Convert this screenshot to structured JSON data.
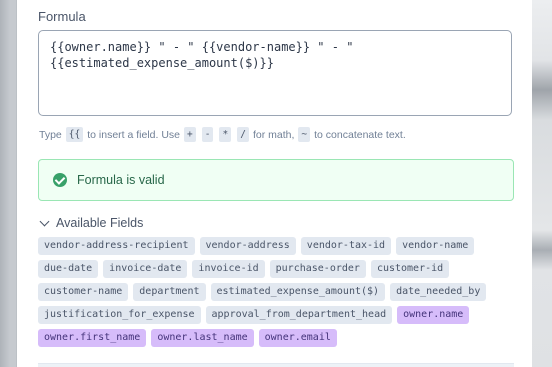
{
  "formula": {
    "label": "Formula",
    "value": "{{owner.name}} \" - \" {{vendor-name}} \" - \"\n{{estimated_expense_amount($)}}"
  },
  "hint": {
    "type_word": "Type",
    "field_token": "{{",
    "insert_text": "to insert a field. Use",
    "ops": [
      "+",
      "-",
      "*",
      "/"
    ],
    "math_text": "for math,",
    "concat_token": "~",
    "concat_text": "to concatenate text."
  },
  "validation": {
    "message": "Formula is valid",
    "status_color": "#38a169"
  },
  "fields": {
    "title": "Available Fields",
    "rows": [
      [
        {
          "label": "vendor-address-recipient",
          "highlight": false
        },
        {
          "label": "vendor-address",
          "highlight": false
        },
        {
          "label": "vendor-tax-id",
          "highlight": false
        },
        {
          "label": "vendor-name",
          "highlight": false
        }
      ],
      [
        {
          "label": "due-date",
          "highlight": false
        },
        {
          "label": "invoice-date",
          "highlight": false
        },
        {
          "label": "invoice-id",
          "highlight": false
        },
        {
          "label": "purchase-order",
          "highlight": false
        },
        {
          "label": "customer-id",
          "highlight": false
        }
      ],
      [
        {
          "label": "customer-name",
          "highlight": false
        },
        {
          "label": "department",
          "highlight": false
        },
        {
          "label": "estimated_expense_amount($)",
          "highlight": false
        },
        {
          "label": "date_needed_by",
          "highlight": false
        }
      ],
      [
        {
          "label": "justification_for_expense",
          "highlight": false
        },
        {
          "label": "approval_from_department_head",
          "highlight": false
        },
        {
          "label": "owner.name",
          "highlight": true
        }
      ],
      [
        {
          "label": "owner.first_name",
          "highlight": true
        },
        {
          "label": "owner.last_name",
          "highlight": true
        },
        {
          "label": "owner.email",
          "highlight": true
        }
      ]
    ]
  },
  "colors": {
    "chip_default": "#e2e8f0",
    "chip_owner": "#d6bcfa",
    "valid_bg": "#f0fff4",
    "valid_border": "#9ae6b4"
  }
}
